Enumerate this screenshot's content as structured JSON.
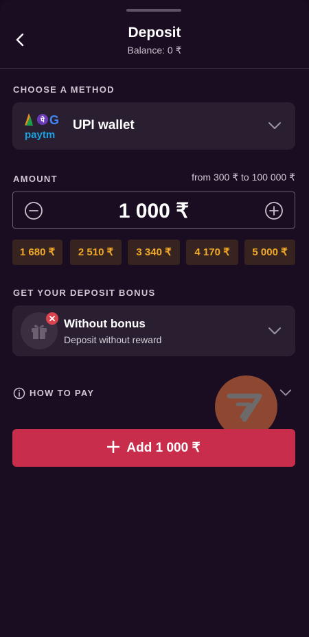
{
  "header": {
    "title": "Deposit",
    "balance": "Balance: 0 ₹"
  },
  "method": {
    "section_label": "CHOOSE A METHOD",
    "name": "UPI wallet",
    "logo_text": "paytm"
  },
  "amount": {
    "section_label": "AMOUNT",
    "range": "from 300 ₹ to 100 000 ₹",
    "value": "1 000 ₹",
    "presets": [
      "1 680 ₹",
      "2 510 ₹",
      "3 340 ₹",
      "4 170 ₹",
      "5 000 ₹"
    ]
  },
  "bonus": {
    "section_label": "GET YOUR DEPOSIT BONUS",
    "title": "Without bonus",
    "subtitle": "Deposit without reward"
  },
  "how_to_pay": {
    "label": "HOW TO PAY"
  },
  "submit": {
    "label": "Add 1 000 ₹"
  },
  "colors": {
    "background": "#1a0d21",
    "card": "#2a1f30",
    "accent": "#c82d4c",
    "chip_text": "#f0a92a"
  }
}
